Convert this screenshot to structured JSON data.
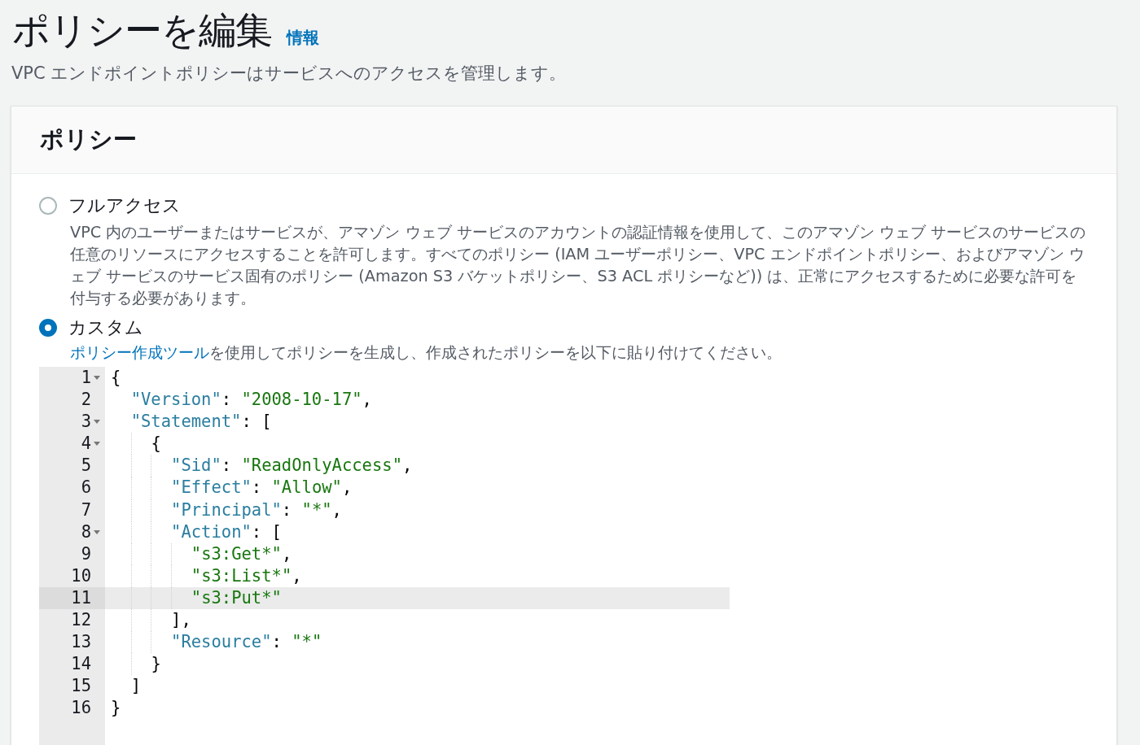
{
  "page": {
    "title": "ポリシーを編集",
    "info_link": "情報",
    "subtitle": "VPC エンドポイントポリシーはサービスへのアクセスを管理します。"
  },
  "policy": {
    "heading": "ポリシー",
    "options": [
      {
        "label": "フルアクセス",
        "selected": false,
        "description": "VPC 内のユーザーまたはサービスが、アマゾン ウェブ サービスのアカウントの認証情報を使用して、このアマゾン ウェブ サービスのサービスの任意のリソースにアクセスすることを許可します。すべてのポリシー (IAM ユーザーポリシー、VPC エンドポイントポリシー、およびアマゾン ウェブ サービスのサービス固有のポリシー (Amazon S3 バケットポリシー、S3 ACL ポリシーなど)) は、正常にアクセスするために必要な許可を付与する必要があります。"
      },
      {
        "label": "カスタム",
        "selected": true,
        "hint_link": "ポリシー作成ツール",
        "hint": "を使用してポリシーを生成し、作成されたポリシーを以下に貼り付けてください。"
      }
    ],
    "editor": {
      "lines": [
        {
          "number": "1",
          "foldable": true,
          "active": false,
          "tokens": [
            {
              "kind": "punct",
              "text": "{"
            }
          ]
        },
        {
          "number": "2",
          "foldable": false,
          "active": false,
          "tokens": [
            {
              "kind": "key",
              "text": "\"Version\""
            },
            {
              "kind": "punct",
              "text": ": "
            },
            {
              "kind": "string",
              "text": "\"2008-10-17\""
            },
            {
              "kind": "punct",
              "text": ","
            }
          ]
        },
        {
          "number": "3",
          "foldable": true,
          "active": false,
          "tokens": [
            {
              "kind": "key",
              "text": "\"Statement\""
            },
            {
              "kind": "punct",
              "text": ": ["
            }
          ]
        },
        {
          "number": "4",
          "foldable": true,
          "active": false,
          "tokens": [
            {
              "kind": "punct",
              "text": "{"
            }
          ]
        },
        {
          "number": "5",
          "foldable": false,
          "active": false,
          "tokens": [
            {
              "kind": "key",
              "text": "\"Sid\""
            },
            {
              "kind": "punct",
              "text": ": "
            },
            {
              "kind": "string",
              "text": "\"ReadOnlyAccess\""
            },
            {
              "kind": "punct",
              "text": ","
            }
          ]
        },
        {
          "number": "6",
          "foldable": false,
          "active": false,
          "tokens": [
            {
              "kind": "key",
              "text": "\"Effect\""
            },
            {
              "kind": "punct",
              "text": ": "
            },
            {
              "kind": "string",
              "text": "\"Allow\""
            },
            {
              "kind": "punct",
              "text": ","
            }
          ]
        },
        {
          "number": "7",
          "foldable": false,
          "active": false,
          "tokens": [
            {
              "kind": "key",
              "text": "\"Principal\""
            },
            {
              "kind": "punct",
              "text": ": "
            },
            {
              "kind": "string",
              "text": "\"*\""
            },
            {
              "kind": "punct",
              "text": ","
            }
          ]
        },
        {
          "number": "8",
          "foldable": true,
          "active": false,
          "tokens": [
            {
              "kind": "key",
              "text": "\"Action\""
            },
            {
              "kind": "punct",
              "text": ": ["
            }
          ]
        },
        {
          "number": "9",
          "foldable": false,
          "active": false,
          "tokens": [
            {
              "kind": "string",
              "text": "\"s3:Get*\""
            },
            {
              "kind": "punct",
              "text": ","
            }
          ]
        },
        {
          "number": "10",
          "foldable": false,
          "active": false,
          "tokens": [
            {
              "kind": "string",
              "text": "\"s3:List*\""
            },
            {
              "kind": "punct",
              "text": ","
            }
          ]
        },
        {
          "number": "11",
          "foldable": false,
          "active": true,
          "tokens": [
            {
              "kind": "string",
              "text": "\"s3:Put*\""
            }
          ]
        },
        {
          "number": "12",
          "foldable": false,
          "active": false,
          "tokens": [
            {
              "kind": "punct",
              "text": "],"
            }
          ]
        },
        {
          "number": "13",
          "foldable": false,
          "active": false,
          "tokens": [
            {
              "kind": "key",
              "text": "\"Resource\""
            },
            {
              "kind": "punct",
              "text": ": "
            },
            {
              "kind": "string",
              "text": "\"*\""
            }
          ]
        },
        {
          "number": "14",
          "foldable": false,
          "active": false,
          "tokens": [
            {
              "kind": "punct",
              "text": "}"
            }
          ]
        },
        {
          "number": "15",
          "foldable": false,
          "active": false,
          "tokens": [
            {
              "kind": "punct",
              "text": "]"
            }
          ]
        },
        {
          "number": "16",
          "foldable": false,
          "active": false,
          "tokens": [
            {
              "kind": "punct",
              "text": "}"
            }
          ]
        }
      ]
    }
  }
}
